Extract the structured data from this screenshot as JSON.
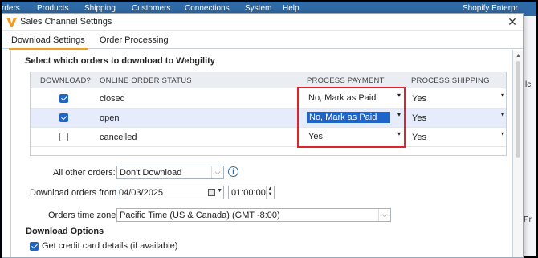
{
  "background_app": {
    "nav_items": [
      "rders",
      "Products",
      "Shipping",
      "Customers",
      "Connections",
      "System",
      "Help"
    ],
    "right_text": "Shopify Enterpr",
    "peek_left": "Pr",
    "peek_right_top": "lc",
    "peek_right_bottom": "Pr"
  },
  "dialog": {
    "title": "Sales Channel Settings",
    "close_glyph": "✕"
  },
  "tabs": [
    {
      "label": "Download Settings",
      "active": true
    },
    {
      "label": "Order Processing",
      "active": false
    }
  ],
  "section_heading": "Select which orders to download to Webgility",
  "table": {
    "headers": [
      "DOWNLOAD?",
      "ONLINE ORDER STATUS",
      "PROCESS PAYMENT",
      "PROCESS SHIPPING"
    ],
    "rows": [
      {
        "download": true,
        "status": "closed",
        "payment": "No, Mark as Paid",
        "shipping": "Yes",
        "selected": false,
        "payment_highlight": false
      },
      {
        "download": true,
        "status": "open",
        "payment": "No, Mark as Paid",
        "shipping": "Yes",
        "selected": true,
        "payment_highlight": true
      },
      {
        "download": false,
        "status": "cancelled",
        "payment": "Yes",
        "shipping": "Yes",
        "selected": false,
        "payment_highlight": false
      }
    ]
  },
  "form": {
    "all_other_orders_label": "All other orders:",
    "all_other_orders_value": "Don't Download",
    "download_from_label": "Download orders from:",
    "download_from_date": "04/03/2025",
    "download_from_time": "01:00:00",
    "time_zone_label": "Orders time zone:",
    "time_zone_value": "Pacific Time (US & Canada) (GMT -8:00)"
  },
  "download_options": {
    "heading": "Download Options",
    "options": [
      {
        "label": "Get credit card details (if available)",
        "checked": true
      }
    ]
  },
  "colors": {
    "accent": "#f59a23",
    "selection": "#1f64c8",
    "annotation_box": "#e0222a"
  }
}
